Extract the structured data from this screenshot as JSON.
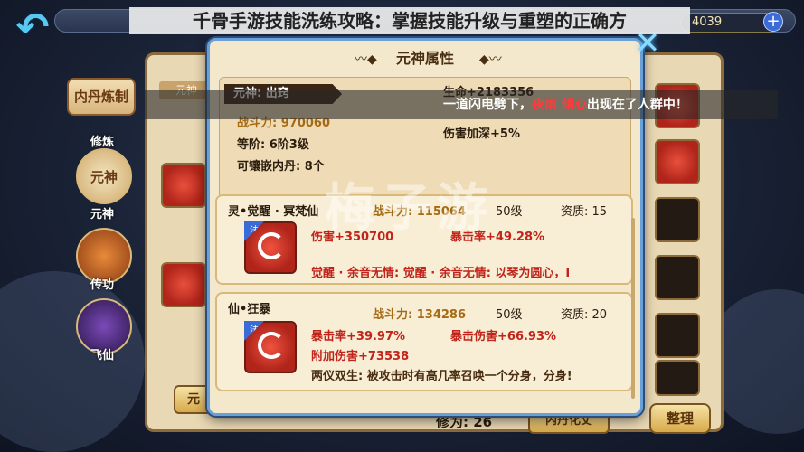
{
  "header": {
    "gold_value": "4039",
    "gold_plus": "+"
  },
  "headline": "千骨手游技能洗练攻略：掌握技能升级与重塑的正确方",
  "subtitle": {
    "prefix": "一道闪电劈下，",
    "name": "夜雨 傾心",
    "suffix": "出现在了人群中！"
  },
  "left_nav": {
    "tab_neidan": "内丹炼制",
    "xiulian": "修炼",
    "yuanshen": "元神",
    "yuanshen_label": "元神",
    "chuangong": "传功",
    "feixian": "飞仙"
  },
  "back_panel": {
    "tab_label": "元神",
    "bottom_left_btn": "元",
    "xiuwei_label": "修为: 26",
    "mid_btn": "内丹化丈",
    "organize_btn": "整理"
  },
  "modal": {
    "title": "元神属性",
    "close": "✕",
    "stats": {
      "shen_label": "元神: 出窍",
      "combat_power": "战斗力: 970060",
      "rank": "等阶: 6阶3级",
      "slots": "可镶嵌内丹: 8个",
      "hp": "生命+2183356",
      "damage_bonus": "伤害加深+5%"
    },
    "skills": [
      {
        "tag": "法",
        "name": "灵•觉醒 · 冥梵仙",
        "power": "战斗力: 115064",
        "level": "50级",
        "quality": "资质: 15",
        "line1_a": "伤害+350700",
        "line1_b": "暴击率+49.28%",
        "line2": "觉醒 · 余音无情: 觉醒 · 余音无情: 以琴为圆心，I"
      },
      {
        "tag": "法",
        "name": "仙•狂暴",
        "power": "战斗力: 134286",
        "level": "50级",
        "quality": "资质: 20",
        "line1_a": "暴击率+39.97%",
        "line1_b": "暴击伤害+66.93%",
        "line2": "附加伤害+73538",
        "line3": "两仪双生: 被攻击时有高几率召唤一个分身，分身!"
      }
    ]
  },
  "watermark": "梅子游"
}
